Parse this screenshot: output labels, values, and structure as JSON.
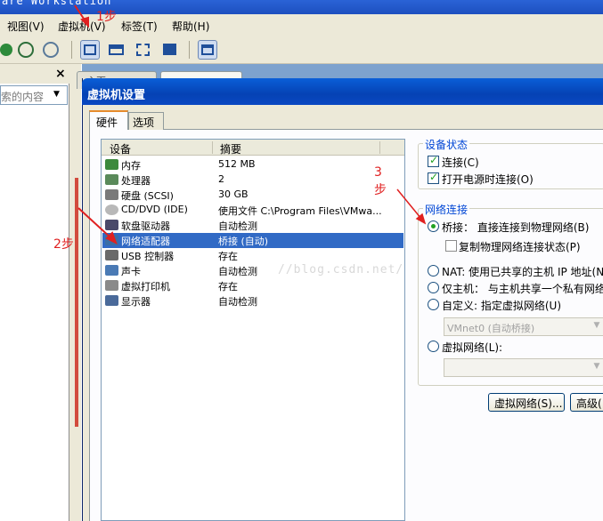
{
  "app": {
    "title": "are Workstation"
  },
  "menu": {
    "items": [
      "视图(V)",
      "虚拟机(V)",
      "标签(T)",
      "帮助(H)"
    ]
  },
  "sidebar": {
    "search_placeholder": "索的内容",
    "close": "×"
  },
  "background_tabs": {
    "first": "主页"
  },
  "dialog": {
    "title": "虚拟机设置",
    "tabs": [
      "硬件",
      "选项"
    ],
    "device_list": {
      "headers": [
        "设备",
        "摘要"
      ],
      "rows": [
        {
          "name": "内存",
          "summary": "512 MB",
          "icon": "memory-icon",
          "selected": false
        },
        {
          "name": "处理器",
          "summary": "2",
          "icon": "processor-icon",
          "selected": false
        },
        {
          "name": "硬盘 (SCSI)",
          "summary": "30 GB",
          "icon": "hard-disk-icon",
          "selected": false
        },
        {
          "name": "CD/DVD (IDE)",
          "summary": "使用文件 C:\\Program Files\\VMwa...",
          "icon": "cd-dvd-icon",
          "selected": false
        },
        {
          "name": "软盘驱动器",
          "summary": "自动检测",
          "icon": "floppy-icon",
          "selected": false
        },
        {
          "name": "网络适配器",
          "summary": "桥接 (自动)",
          "icon": "network-adapter-icon",
          "selected": true
        },
        {
          "name": "USB 控制器",
          "summary": "存在",
          "icon": "usb-icon",
          "selected": false
        },
        {
          "name": "声卡",
          "summary": "自动检测",
          "icon": "sound-card-icon",
          "selected": false
        },
        {
          "name": "虚拟打印机",
          "summary": "存在",
          "icon": "printer-icon",
          "selected": false
        },
        {
          "name": "显示器",
          "summary": "自动检测",
          "icon": "display-icon",
          "selected": false
        }
      ]
    },
    "device_status": {
      "title": "设备状态",
      "connected": {
        "label": "连接(C)",
        "checked": true
      },
      "connect_at_power_on": {
        "label": "打开电源时连接(O)",
        "checked": true
      }
    },
    "network_connection": {
      "title": "网络连接",
      "bridged": {
        "label": "桥接： 直接连接到物理网络(B)",
        "selected": true
      },
      "replicate": {
        "label": "复制物理网络连接状态(P)",
        "checked": false
      },
      "nat": {
        "label": "NAT: 使用已共享的主机 IP 地址(N",
        "selected": false
      },
      "host_only": {
        "label": "仅主机： 与主机共享一个私有网络",
        "selected": false
      },
      "custom": {
        "label": "自定义: 指定虚拟网络(U)",
        "selected": false
      },
      "custom_value": "VMnet0 (自动桥接)",
      "lan_segment": {
        "label": "虚拟网络(L):",
        "selected": false
      },
      "lan_segment_value": ""
    },
    "buttons": {
      "virtual_network": "虚拟网络(S)...",
      "advanced": "高级("
    }
  },
  "annotations": {
    "step1": "1步",
    "step2": "2步",
    "step3": "3\n步"
  },
  "watermark": "//blog.csdn.net/",
  "colors": {
    "annotation": "#e02020",
    "selection": "#316ac5",
    "group_title": "#0046d5",
    "title_bar": "#0542b4"
  }
}
